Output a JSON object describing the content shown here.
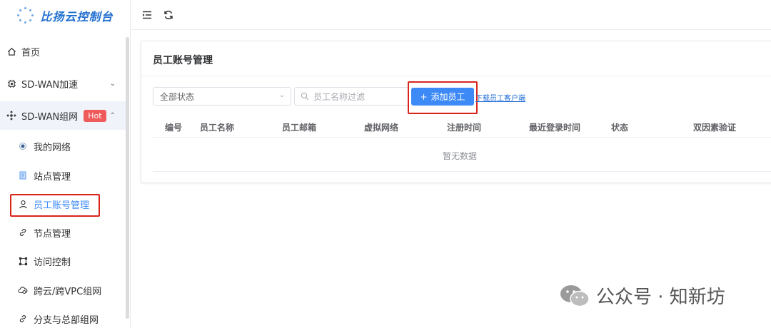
{
  "app": {
    "title": "比扬云控制台"
  },
  "sidebar": {
    "items": [
      {
        "label": "首页",
        "icon": "home-icon"
      },
      {
        "label": "SD-WAN加速",
        "icon": "chip-icon"
      },
      {
        "label": "SD-WAN组网",
        "icon": "network-icon",
        "badge": "Hot"
      },
      {
        "label": "我的网络",
        "icon": "dot-icon"
      },
      {
        "label": "站点管理",
        "icon": "document-icon"
      },
      {
        "label": "员工账号管理",
        "icon": "user-icon"
      },
      {
        "label": "节点管理",
        "icon": "link-icon"
      },
      {
        "label": "访问控制",
        "icon": "nodes-icon"
      },
      {
        "label": "跨云/跨VPC组网",
        "icon": "cloud-icon"
      },
      {
        "label": "分支与总部组网",
        "icon": "link-icon"
      }
    ]
  },
  "main": {
    "title": "员工账号管理",
    "filter": {
      "status_value": "全部状态",
      "search_placeholder": "员工名称过滤"
    },
    "add_button": "添加员工",
    "download_link": "下载员工客户端",
    "table": {
      "columns": [
        "编号",
        "员工名称",
        "员工邮箱",
        "虚拟网络",
        "注册时间",
        "最近登录时间",
        "状态",
        "双因素验证"
      ],
      "empty_text": "暂无数据"
    }
  },
  "watermark": {
    "text": "公众号 · 知新坊"
  },
  "colors": {
    "accent": "#3d8af7",
    "highlight": "#d9241c",
    "hot": "#ef5a5a"
  }
}
